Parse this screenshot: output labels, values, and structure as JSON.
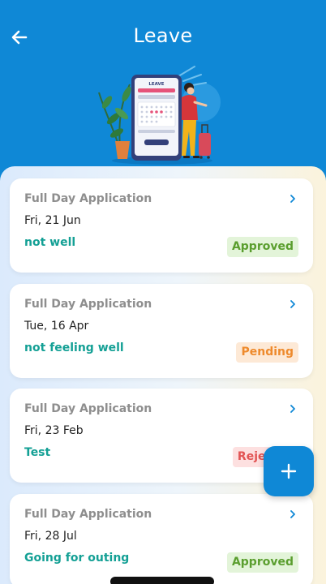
{
  "header": {
    "title": "Leave"
  },
  "illustration": {
    "screen_label": "LEAVE"
  },
  "leaves": [
    {
      "type": "Full Day Application",
      "date": "Fri, 21 Jun",
      "reason": "not well",
      "status": "Approved"
    },
    {
      "type": "Full Day Application",
      "date": "Tue, 16 Apr",
      "reason": "not feeling well",
      "status": "Pending"
    },
    {
      "type": "Full Day Application",
      "date": "Fri, 23 Feb",
      "reason": "Test",
      "status": "Rejected"
    },
    {
      "type": "Full Day Application",
      "date": "Fri, 28 Jul",
      "reason": "Going for outing",
      "status": "Approved"
    }
  ],
  "colors": {
    "primary": "#0f88d6",
    "reason": "#14a095",
    "approved": "#5a9e2e",
    "pending": "#ee8a2c",
    "rejected": "#e25454"
  },
  "icons": {
    "back": "arrow-left-icon",
    "open": "chevron-right-icon",
    "add": "plus-icon"
  }
}
